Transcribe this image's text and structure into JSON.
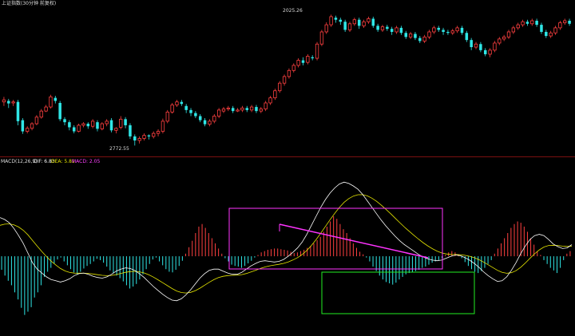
{
  "colors": {
    "background": "#000000",
    "up": "#ff4040",
    "down": "#2fe6e6",
    "separator": "#7a1010",
    "dif_line": "#ffffff",
    "dea_line": "#e6e600",
    "macd_label": "#ff40ff",
    "box_magenta": "#ff33ff",
    "box_green": "#22ee22",
    "trend_line": "#ff33ff",
    "header_text": "#dddddd"
  },
  "header": {
    "title": "上证指数(30分钟 前复权)"
  },
  "macd_header": {
    "name": "MACD(12,26,9)",
    "dif": "DIF: 6.83",
    "dea": "DEA: 5.81",
    "macd": "MACD: 2.05"
  },
  "chart_data": [
    {
      "type": "candlestick",
      "title": "上证指数(30分钟 前复权)",
      "annotations": [
        {
          "label": "2772.55",
          "kind": "low"
        },
        {
          "label": "2025.26",
          "kind": "high"
        }
      ],
      "ylim": [
        2760,
        3040
      ],
      "candles": [
        [
          2858,
          2862,
          2850,
          2868
        ],
        [
          2860,
          2855,
          2846,
          2864
        ],
        [
          2856,
          2858,
          2850,
          2862
        ],
        [
          2858,
          2820,
          2812,
          2862
        ],
        [
          2822,
          2800,
          2795,
          2826
        ],
        [
          2800,
          2806,
          2796,
          2810
        ],
        [
          2806,
          2815,
          2802,
          2818
        ],
        [
          2815,
          2828,
          2812,
          2832
        ],
        [
          2828,
          2840,
          2825,
          2844
        ],
        [
          2840,
          2848,
          2838,
          2852
        ],
        [
          2848,
          2868,
          2845,
          2872
        ],
        [
          2866,
          2860,
          2855,
          2870
        ],
        [
          2856,
          2824,
          2820,
          2860
        ],
        [
          2824,
          2818,
          2812,
          2828
        ],
        [
          2818,
          2808,
          2802,
          2822
        ],
        [
          2808,
          2800,
          2796,
          2812
        ],
        [
          2800,
          2812,
          2798,
          2815
        ],
        [
          2812,
          2815,
          2808,
          2818
        ],
        [
          2815,
          2810,
          2805,
          2818
        ],
        [
          2810,
          2820,
          2806,
          2824
        ],
        [
          2818,
          2805,
          2800,
          2822
        ],
        [
          2805,
          2815,
          2802,
          2818
        ],
        [
          2815,
          2820,
          2810,
          2824
        ],
        [
          2822,
          2802,
          2798,
          2826
        ],
        [
          2802,
          2806,
          2796,
          2808
        ],
        [
          2808,
          2824,
          2804,
          2830
        ],
        [
          2824,
          2812,
          2806,
          2828
        ],
        [
          2812,
          2790,
          2785,
          2816
        ],
        [
          2790,
          2782,
          2772,
          2794
        ],
        [
          2782,
          2786,
          2776,
          2790
        ],
        [
          2786,
          2792,
          2782,
          2796
        ],
        [
          2792,
          2790,
          2784,
          2794
        ],
        [
          2790,
          2796,
          2786,
          2800
        ],
        [
          2796,
          2800,
          2790,
          2804
        ],
        [
          2800,
          2820,
          2796,
          2825
        ],
        [
          2820,
          2838,
          2816,
          2842
        ],
        [
          2838,
          2852,
          2835,
          2856
        ],
        [
          2852,
          2858,
          2848,
          2862
        ],
        [
          2858,
          2854,
          2850,
          2862
        ],
        [
          2850,
          2842,
          2836,
          2854
        ],
        [
          2842,
          2836,
          2830,
          2846
        ],
        [
          2836,
          2830,
          2826,
          2840
        ],
        [
          2830,
          2822,
          2818,
          2834
        ],
        [
          2822,
          2814,
          2810,
          2826
        ],
        [
          2814,
          2820,
          2810,
          2824
        ],
        [
          2820,
          2830,
          2816,
          2834
        ],
        [
          2830,
          2842,
          2826,
          2846
        ],
        [
          2840,
          2844,
          2836,
          2848
        ],
        [
          2844,
          2846,
          2840,
          2850
        ],
        [
          2846,
          2840,
          2836,
          2850
        ],
        [
          2840,
          2842,
          2838,
          2846
        ],
        [
          2842,
          2846,
          2838,
          2850
        ],
        [
          2846,
          2842,
          2838,
          2850
        ],
        [
          2842,
          2848,
          2838,
          2852
        ],
        [
          2848,
          2840,
          2836,
          2852
        ],
        [
          2840,
          2844,
          2836,
          2848
        ],
        [
          2844,
          2856,
          2840,
          2860
        ],
        [
          2856,
          2866,
          2852,
          2870
        ],
        [
          2866,
          2880,
          2862,
          2884
        ],
        [
          2880,
          2895,
          2876,
          2899
        ],
        [
          2895,
          2908,
          2890,
          2912
        ],
        [
          2908,
          2920,
          2904,
          2924
        ],
        [
          2920,
          2930,
          2916,
          2934
        ],
        [
          2930,
          2940,
          2926,
          2944
        ],
        [
          2940,
          2935,
          2930,
          2946
        ],
        [
          2936,
          2948,
          2932,
          2952
        ],
        [
          2946,
          2944,
          2940,
          2950
        ],
        [
          2944,
          2972,
          2940,
          2976
        ],
        [
          2972,
          2996,
          2968,
          3000
        ],
        [
          2996,
          3010,
          2992,
          3015
        ],
        [
          3010,
          3026,
          3006,
          3030
        ],
        [
          3024,
          3020,
          3014,
          3028
        ],
        [
          3020,
          3016,
          3010,
          3024
        ],
        [
          3016,
          3000,
          2996,
          3020
        ],
        [
          3000,
          3012,
          2996,
          3016
        ],
        [
          3012,
          3020,
          3008,
          3024
        ],
        [
          3020,
          3008,
          3002,
          3024
        ],
        [
          3008,
          3016,
          3004,
          3020
        ],
        [
          3016,
          3022,
          3012,
          3026
        ],
        [
          3022,
          3008,
          3004,
          3026
        ],
        [
          3008,
          3000,
          2996,
          3012
        ],
        [
          3000,
          3006,
          2996,
          3010
        ],
        [
          3006,
          3002,
          2998,
          3010
        ],
        [
          3002,
          2996,
          2990,
          3006
        ],
        [
          2996,
          3004,
          2992,
          3008
        ],
        [
          3004,
          2994,
          2990,
          3008
        ],
        [
          2994,
          2986,
          2982,
          2998
        ],
        [
          2986,
          2992,
          2982,
          2996
        ],
        [
          2992,
          2984,
          2980,
          2996
        ],
        [
          2984,
          2978,
          2974,
          2988
        ],
        [
          2978,
          2986,
          2974,
          2990
        ],
        [
          2986,
          2996,
          2982,
          3000
        ],
        [
          2996,
          3004,
          2992,
          3008
        ],
        [
          3004,
          3000,
          2996,
          3008
        ],
        [
          3000,
          2996,
          2990,
          3004
        ],
        [
          2996,
          2994,
          2990,
          3000
        ],
        [
          2994,
          2998,
          2990,
          3002
        ],
        [
          2998,
          3004,
          2994,
          3008
        ],
        [
          3004,
          2994,
          2990,
          3008
        ],
        [
          2994,
          2980,
          2976,
          2998
        ],
        [
          2980,
          2966,
          2960,
          2984
        ],
        [
          2966,
          2972,
          2962,
          2976
        ],
        [
          2972,
          2960,
          2956,
          2976
        ],
        [
          2960,
          2952,
          2948,
          2964
        ],
        [
          2952,
          2960,
          2946,
          2964
        ],
        [
          2960,
          2974,
          2956,
          2978
        ],
        [
          2974,
          2982,
          2970,
          2986
        ],
        [
          2982,
          2986,
          2978,
          2990
        ],
        [
          2986,
          2996,
          2982,
          3000
        ],
        [
          2996,
          3004,
          2992,
          3008
        ],
        [
          3004,
          3010,
          3000,
          3014
        ],
        [
          3010,
          3016,
          3006,
          3020
        ],
        [
          3016,
          3012,
          3008,
          3020
        ],
        [
          3012,
          3018,
          3008,
          3022
        ],
        [
          3018,
          3010,
          3006,
          3022
        ],
        [
          3010,
          2996,
          2992,
          3014
        ],
        [
          2996,
          2988,
          2984,
          3000
        ],
        [
          2988,
          2994,
          2984,
          2998
        ],
        [
          2994,
          3004,
          2990,
          3008
        ],
        [
          3004,
          3014,
          3000,
          3018
        ],
        [
          3014,
          3018,
          3010,
          3022
        ],
        [
          3018,
          3012,
          3008,
          3022
        ]
      ]
    },
    {
      "type": "bar",
      "title": "MACD(12,26,9)",
      "series_names": [
        "DIF",
        "DEA",
        "MACD"
      ],
      "ylim": [
        -12,
        14
      ],
      "hist": [
        -2.1,
        -3.0,
        -3.8,
        -4.5,
        -5.6,
        -6.7,
        -8.0,
        -9.1,
        -8.6,
        -7.9,
        -6.4,
        -5.6,
        -4.5,
        -3.2,
        -2.4,
        -1.8,
        -1.1,
        -0.5,
        -0.2,
        -0.8,
        -1.4,
        -2.0,
        -2.5,
        -2.8,
        -2.4,
        -1.9,
        -1.5,
        -1.2,
        -0.8,
        -0.4,
        -0.6,
        -1.0,
        -1.6,
        -2.2,
        -2.6,
        -3.0,
        -3.4,
        -3.9,
        -4.5,
        -5.0,
        -4.7,
        -4.3,
        -3.6,
        -2.8,
        -2.0,
        -1.2,
        -0.5,
        -0.2,
        -0.8,
        -1.4,
        -2.0,
        -2.4,
        -2.5,
        -2.1,
        -1.5,
        -0.7,
        0.4,
        1.4,
        2.4,
        3.6,
        4.6,
        5.0,
        4.4,
        3.6,
        2.8,
        2.0,
        1.2,
        0.4,
        -0.3,
        -0.8,
        -1.3,
        -1.5,
        -1.6,
        -1.8,
        -1.5,
        -1.1,
        -0.7,
        -0.2,
        0.2,
        0.6,
        0.8,
        1.0,
        1.1,
        1.2,
        1.2,
        1.1,
        1.0,
        0.9,
        0.7,
        0.5,
        0.6,
        0.8,
        1.0,
        1.3,
        1.6,
        2.0,
        2.5,
        3.0,
        3.8,
        4.6,
        5.4,
        6.2,
        5.8,
        5.0,
        4.2,
        3.6,
        2.8,
        2.0,
        1.3,
        0.7,
        0.3,
        -0.2,
        -0.8,
        -1.6,
        -2.3,
        -3.0,
        -3.6,
        -4.0,
        -4.2,
        -4.4,
        -4.1,
        -3.6,
        -3.2,
        -2.8,
        -2.6,
        -2.5,
        -2.3,
        -2.1,
        -1.8,
        -1.6,
        -1.3,
        -1.0,
        -0.8,
        -0.6,
        -0.3,
        0.2,
        0.6,
        0.8,
        0.6,
        0.3,
        -0.3,
        -0.9,
        -1.5,
        -2.0,
        -2.4,
        -2.6,
        -2.3,
        -1.8,
        -1.2,
        -0.6,
        0.4,
        1.2,
        2.0,
        2.8,
        3.6,
        4.4,
        5.0,
        5.4,
        5.2,
        4.6,
        3.8,
        2.8,
        1.8,
        0.8,
        0.2,
        -0.6,
        -1.2,
        -1.8,
        -2.2,
        -2.6,
        -1.8,
        -0.6,
        0.4,
        0.8
      ],
      "dif": [
        6.0,
        5.7,
        5.2,
        4.3,
        3.2,
        2.0,
        0.5,
        -1.0,
        -2.0,
        -2.6,
        -3.2,
        -3.6,
        -3.8,
        -4.0,
        -3.8,
        -3.5,
        -3.0,
        -2.7,
        -2.6,
        -2.8,
        -3.1,
        -3.3,
        -3.4,
        -3.2,
        -2.8,
        -2.3,
        -2.0,
        -1.8,
        -1.9,
        -2.2,
        -2.7,
        -3.3,
        -4.0,
        -4.7,
        -5.3,
        -5.9,
        -6.4,
        -6.8,
        -6.9,
        -6.6,
        -6.0,
        -5.2,
        -4.3,
        -3.4,
        -2.7,
        -2.2,
        -2.0,
        -2.0,
        -2.3,
        -2.6,
        -2.8,
        -2.8,
        -2.5,
        -2.0,
        -1.5,
        -1.1,
        -0.8,
        -0.7,
        -0.8,
        -0.9,
        -0.8,
        -0.5,
        0.0,
        0.6,
        1.3,
        2.2,
        3.4,
        4.8,
        6.2,
        7.6,
        8.8,
        9.8,
        10.6,
        11.2,
        11.5,
        11.3,
        10.9,
        10.4,
        9.6,
        8.6,
        7.6,
        6.6,
        5.6,
        4.7,
        3.9,
        3.1,
        2.4,
        1.8,
        1.3,
        0.8,
        0.3,
        -0.1,
        -0.4,
        -0.6,
        -0.7,
        -0.6,
        -0.3,
        0.0,
        0.2,
        0.1,
        -0.2,
        -0.6,
        -1.1,
        -1.7,
        -2.4,
        -3.0,
        -3.5,
        -3.9,
        -3.8,
        -3.2,
        -2.2,
        -1.0,
        0.4,
        1.6,
        2.6,
        3.2,
        3.4,
        3.2,
        2.6,
        1.9,
        1.5,
        1.2,
        1.3,
        1.8
      ]
    }
  ]
}
